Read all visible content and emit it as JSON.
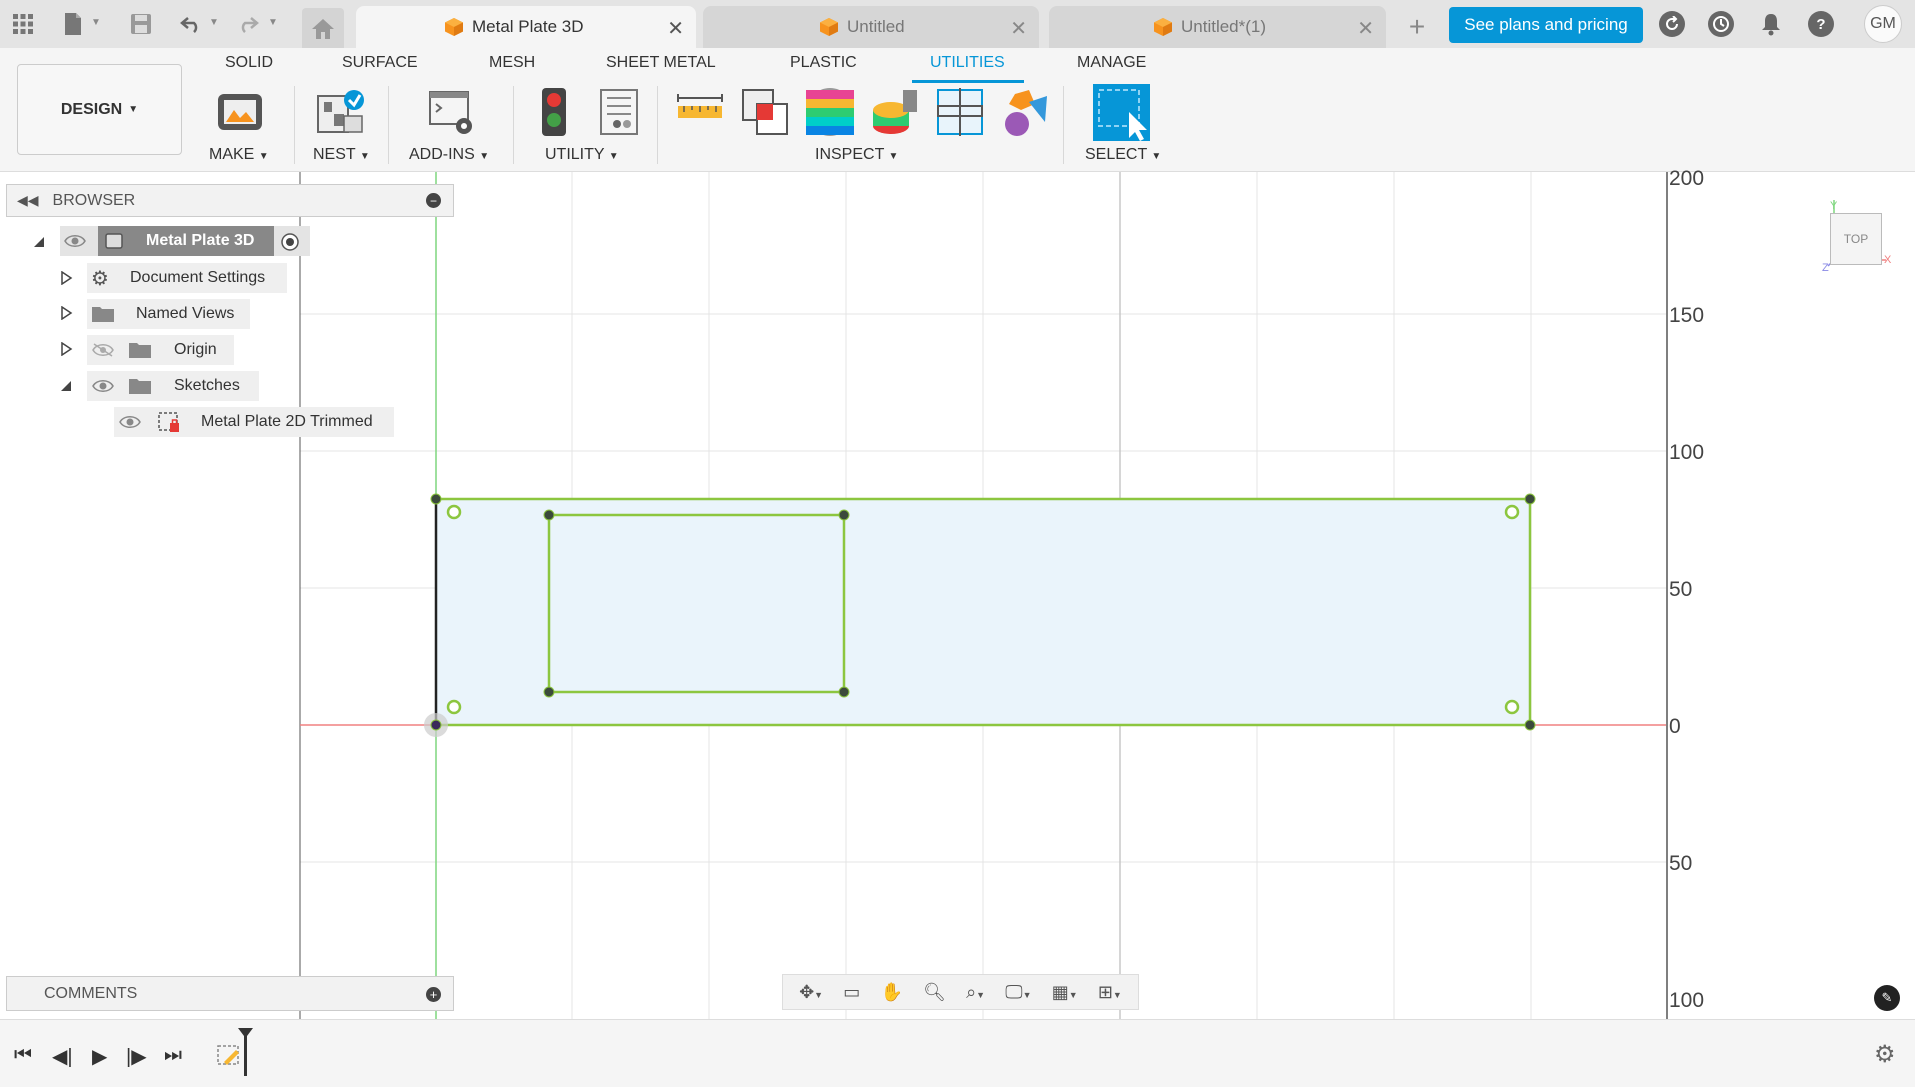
{
  "titlebar": {
    "tabs": [
      {
        "label": "Metal Plate 3D",
        "active": true
      },
      {
        "label": "Untitled",
        "active": false
      },
      {
        "label": "Untitled*(1)",
        "active": false
      }
    ],
    "plans_button": "See plans and pricing",
    "avatar_initials": "GM",
    "help_glyph": "?"
  },
  "ribbon": {
    "workspace": "DESIGN",
    "tabs": [
      "SOLID",
      "SURFACE",
      "MESH",
      "SHEET METAL",
      "PLASTIC",
      "UTILITIES",
      "MANAGE"
    ],
    "active_tab": "UTILITIES",
    "groups": {
      "make": "MAKE",
      "nest": "NEST",
      "addins": "ADD-INS",
      "utility": "UTILITY",
      "inspect": "INSPECT",
      "select": "SELECT"
    }
  },
  "browser": {
    "title": "BROWSER",
    "items": {
      "root": "Metal Plate 3D",
      "document_settings": "Document Settings",
      "named_views": "Named Views",
      "origin": "Origin",
      "sketches": "Sketches",
      "sketch": "Metal Plate 2D Trimmed"
    }
  },
  "comments": {
    "title": "COMMENTS"
  },
  "viewcube": {
    "face": "TOP",
    "axis_y": "Y",
    "axis_x": "X",
    "axis_z": "Z"
  },
  "ruler": {
    "labels": [
      "200",
      "150",
      "100",
      "50",
      "0",
      "50",
      "100"
    ]
  },
  "colors": {
    "accent": "#0696d7",
    "sketch_line": "#8cc63f",
    "profile_fill": "#eaf4fb",
    "x_axis": "#f08080",
    "y_axis": "#7ed67e"
  },
  "icons": {
    "apps": "grid-icon",
    "file": "file-icon",
    "save": "save-icon",
    "undo": "undo-icon",
    "redo": "redo-icon",
    "home": "home-icon",
    "refresh": "refresh-icon",
    "clock": "clock-icon",
    "bell": "bell-icon",
    "help": "help-icon"
  }
}
